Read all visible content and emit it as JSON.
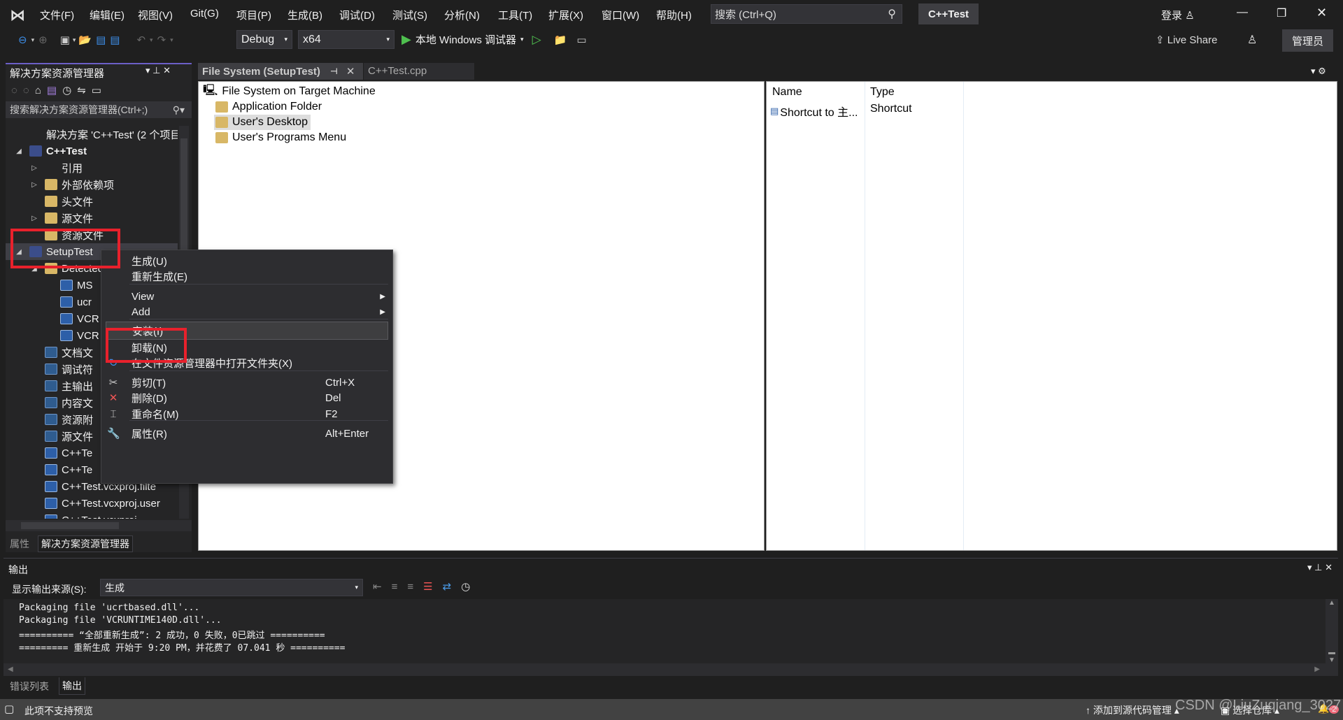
{
  "title_bar": {
    "menus": [
      "文件(F)",
      "编辑(E)",
      "视图(V)",
      "Git(G)",
      "项目(P)",
      "生成(B)",
      "调试(D)",
      "测试(S)",
      "分析(N)",
      "工具(T)",
      "扩展(X)",
      "窗口(W)",
      "帮助(H)"
    ],
    "search_placeholder": "搜索 (Ctrl+Q)",
    "solution_name": "C++Test",
    "login": "登录"
  },
  "toolbar": {
    "config": "Debug",
    "platform": "x64",
    "debugger": "本地 Windows 调试器",
    "live_share": "Live Share",
    "admin": "管理员"
  },
  "solution_explorer": {
    "title": "解决方案资源管理器",
    "search_placeholder": "搜索解决方案资源管理器(Ctrl+;)",
    "items": [
      {
        "label": "解决方案 'C++Test' (2 个项目",
        "level": 0,
        "icon": "solution",
        "exp": ""
      },
      {
        "label": "C++Test",
        "level": 0,
        "icon": "proj",
        "exp": "open",
        "bold": true
      },
      {
        "label": "引用",
        "level": 1,
        "icon": "ref",
        "exp": "closed"
      },
      {
        "label": "外部依赖项",
        "level": 1,
        "icon": "folder",
        "exp": "closed"
      },
      {
        "label": "头文件",
        "level": 1,
        "icon": "folder",
        "exp": ""
      },
      {
        "label": "源文件",
        "level": 1,
        "icon": "folder",
        "exp": "closed"
      },
      {
        "label": "资源文件",
        "level": 1,
        "icon": "folder",
        "exp": ""
      },
      {
        "label": "SetupTest",
        "level": 0,
        "icon": "proj",
        "exp": "open"
      },
      {
        "label": "Detected Dependencies",
        "level": 1,
        "icon": "folder",
        "exp": "open"
      },
      {
        "label": "MS",
        "level": 2,
        "icon": "file",
        "exp": ""
      },
      {
        "label": "ucr",
        "level": 2,
        "icon": "file",
        "exp": ""
      },
      {
        "label": "VCR",
        "level": 2,
        "icon": "file",
        "exp": ""
      },
      {
        "label": "VCR",
        "level": 2,
        "icon": "file",
        "exp": ""
      },
      {
        "label": "文档文",
        "level": 1,
        "icon": "out",
        "exp": ""
      },
      {
        "label": "调试符",
        "level": 1,
        "icon": "out",
        "exp": ""
      },
      {
        "label": "主输出",
        "level": 1,
        "icon": "out",
        "exp": ""
      },
      {
        "label": "内容文",
        "level": 1,
        "icon": "out",
        "exp": ""
      },
      {
        "label": "资源附",
        "level": 1,
        "icon": "out",
        "exp": ""
      },
      {
        "label": "源文件",
        "level": 1,
        "icon": "out",
        "exp": ""
      },
      {
        "label": "C++Te",
        "level": 1,
        "icon": "file",
        "exp": ""
      },
      {
        "label": "C++Te",
        "level": 1,
        "icon": "file",
        "exp": ""
      },
      {
        "label": "C++Test.vcxproj.filte",
        "level": 1,
        "icon": "file",
        "exp": ""
      },
      {
        "label": "C++Test.vcxproj.user",
        "level": 1,
        "icon": "file",
        "exp": ""
      },
      {
        "label": "C++Test.vcxproj",
        "level": 1,
        "icon": "file",
        "exp": ""
      }
    ],
    "bottom_tabs": [
      "属性",
      "解决方案资源管理器"
    ]
  },
  "doc_tabs": [
    "File System (SetupTest)",
    "C++Test.cpp"
  ],
  "file_system": {
    "root": "File System on Target Machine",
    "folders": [
      "Application Folder",
      "User's Desktop",
      "User's Programs Menu"
    ],
    "selected": "User's Desktop",
    "columns": [
      "Name",
      "Type"
    ],
    "rows": [
      {
        "name": "Shortcut to 主...",
        "type": "Shortcut"
      }
    ]
  },
  "context_menu": {
    "items": [
      {
        "label": "生成(U)",
        "shortcut": "",
        "icon": ""
      },
      {
        "label": "重新生成(E)",
        "shortcut": "",
        "icon": ""
      },
      {
        "label": "View",
        "shortcut": "",
        "icon": "",
        "submenu": true
      },
      {
        "label": "Add",
        "shortcut": "",
        "icon": "",
        "submenu": true
      },
      {
        "label": "安装(I)",
        "shortcut": "",
        "icon": "",
        "highlight": true
      },
      {
        "label": "卸载(N)",
        "shortcut": "",
        "icon": ""
      },
      {
        "label": "在文件资源管理器中打开文件夹(X)",
        "shortcut": "",
        "icon": "open-folder"
      },
      {
        "label": "剪切(T)",
        "shortcut": "Ctrl+X",
        "icon": "cut"
      },
      {
        "label": "删除(D)",
        "shortcut": "Del",
        "icon": "delete"
      },
      {
        "label": "重命名(M)",
        "shortcut": "F2",
        "icon": "rename"
      },
      {
        "label": "属性(R)",
        "shortcut": "Alt+Enter",
        "icon": "wrench"
      }
    ]
  },
  "output": {
    "title": "输出",
    "source_label": "显示输出来源(S):",
    "source": "生成",
    "lines": [
      "Packaging file 'ucrtbased.dll'...",
      "Packaging file 'VCRUNTIME140D.dll'...",
      "========== “全部重新生成”: 2 成功，0 失败，0已跳过 ==========",
      "========= 重新生成 开始于 9:20 PM，并花费了 07.041 秒 =========="
    ],
    "tabs": [
      "错误列表",
      "输出"
    ]
  },
  "status_bar": {
    "message": "此项不支持预览",
    "source_control": "添加到源代码管理",
    "repo": "选择仓库",
    "notifications": "2",
    "watermark": "CSDN @LiuZuqiang_3027"
  },
  "colors": {
    "accent": "#6c5fc7",
    "highlight_box": "#e8212c"
  }
}
